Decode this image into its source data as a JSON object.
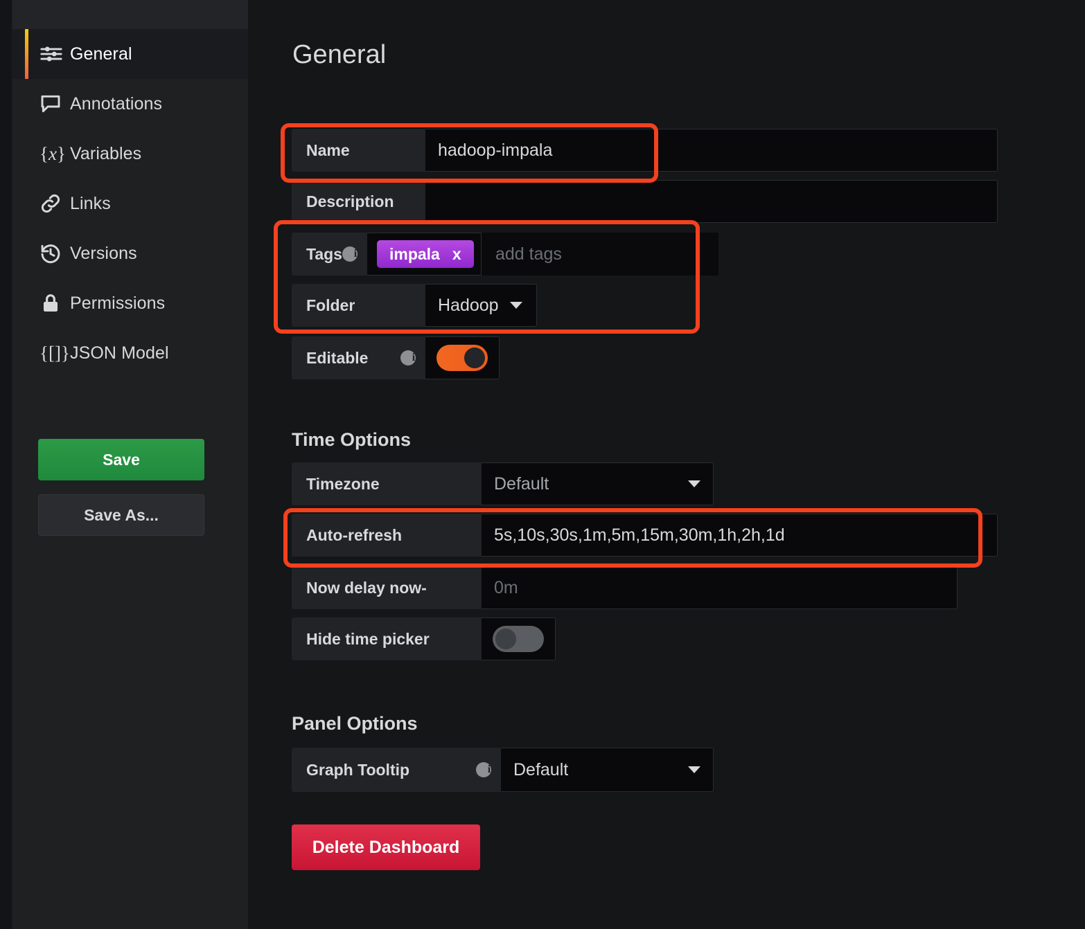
{
  "sidebar": {
    "items": [
      {
        "label": "General",
        "icon": "sliders-icon",
        "active": true
      },
      {
        "label": "Annotations",
        "icon": "comment-icon",
        "active": false
      },
      {
        "label": "Variables",
        "icon": "variable-braces-icon",
        "active": false
      },
      {
        "label": "Links",
        "icon": "link-icon",
        "active": false
      },
      {
        "label": "Versions",
        "icon": "history-icon",
        "active": false
      },
      {
        "label": "Permissions",
        "icon": "lock-icon",
        "active": false
      },
      {
        "label": "JSON Model",
        "icon": "json-braces-icon",
        "active": false
      }
    ],
    "save_label": "Save",
    "save_as_label": "Save As..."
  },
  "main": {
    "page_title": "General",
    "fields": {
      "name_label": "Name",
      "name_value": "hadoop-impala",
      "description_label": "Description",
      "description_value": "",
      "tags_label": "Tags",
      "tags": [
        "impala"
      ],
      "tag_remove_glyph": "x",
      "tags_placeholder": "add tags",
      "folder_label": "Folder",
      "folder_value": "Hadoop",
      "editable_label": "Editable",
      "editable_state": "on"
    },
    "time_options": {
      "section_title": "Time Options",
      "timezone_label": "Timezone",
      "timezone_value": "Default",
      "auto_refresh_label": "Auto-refresh",
      "auto_refresh_value": "5s,10s,30s,1m,5m,15m,30m,1h,2h,1d",
      "now_delay_label": "Now delay now-",
      "now_delay_placeholder": "0m",
      "now_delay_value": "",
      "hide_time_picker_label": "Hide time picker",
      "hide_time_picker_state": "off"
    },
    "panel_options": {
      "section_title": "Panel Options",
      "graph_tooltip_label": "Graph Tooltip",
      "graph_tooltip_value": "Default"
    },
    "delete_label": "Delete Dashboard"
  },
  "annotations": {
    "highlight_color": "#f4411e",
    "boxes": [
      "name-field",
      "tags-and-folder",
      "auto-refresh-field"
    ]
  },
  "colors": {
    "accent_orange": "#f06822",
    "save_green": "#2d9a47",
    "delete_red": "#e0304a",
    "tag_purple": "#b44ae0",
    "highlight_red": "#f4411e",
    "active_bar_top": "#f2cc0c",
    "active_bar_bottom": "#f55f3e"
  }
}
